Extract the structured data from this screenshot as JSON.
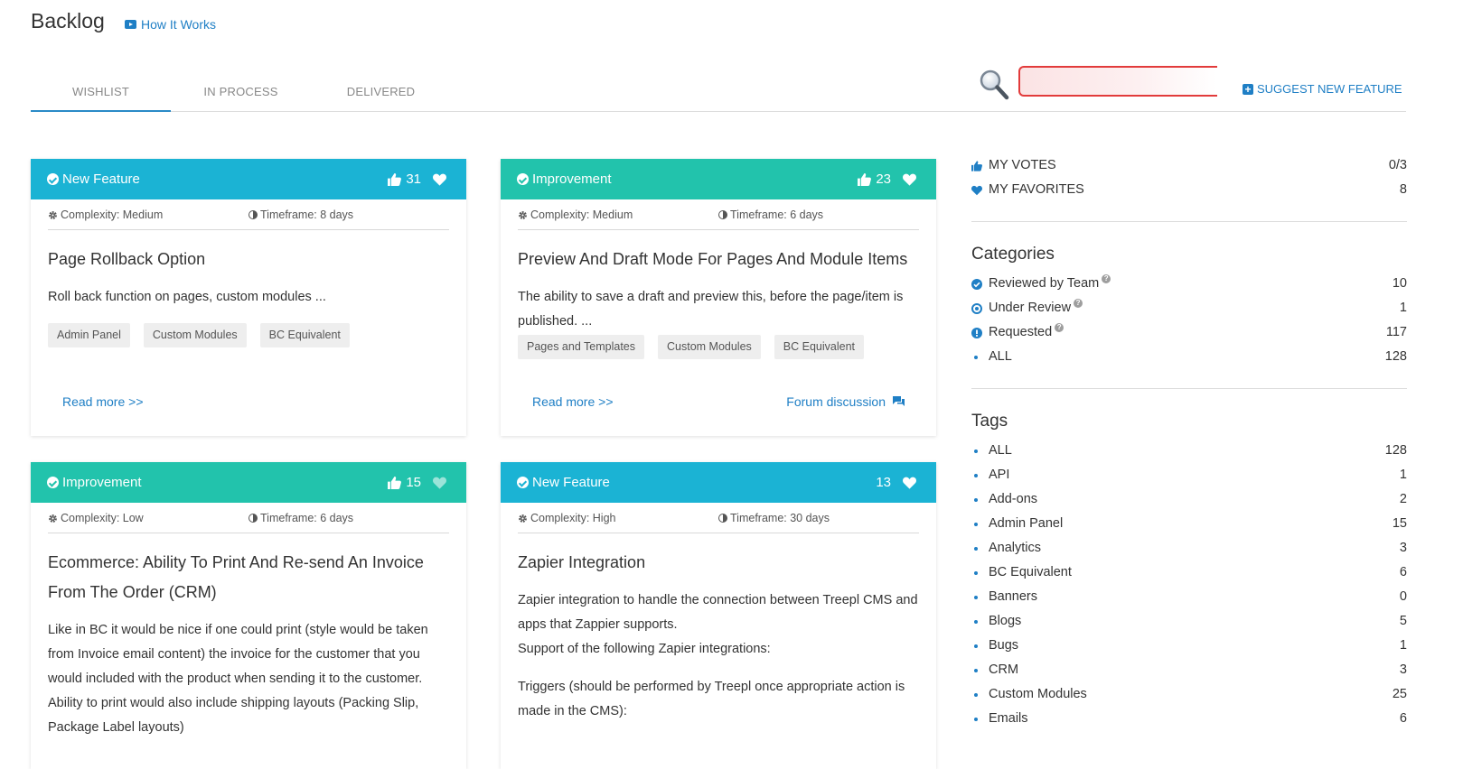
{
  "header": {
    "title": "Backlog",
    "how_it_works": "How It Works",
    "tabs": [
      "WISHLIST",
      "IN PROCESS",
      "DELIVERED"
    ],
    "suggest_label": "SUGGEST NEW FEATURE",
    "search_value": ""
  },
  "cards": [
    {
      "type": "New Feature",
      "votes": "31",
      "complexity": "Complexity: Medium",
      "timeframe": "Timeframe: 8 days",
      "title": "Page Rollback Option",
      "desc": "Roll back function on pages, custom modules ...",
      "tags": [
        "Admin Panel",
        "Custom Modules",
        "BC Equivalent"
      ],
      "read_more": "Read more >>"
    },
    {
      "type": "Improvement",
      "votes": "23",
      "complexity": "Complexity: Medium",
      "timeframe": "Timeframe: 6 days",
      "title": "Preview And Draft Mode For Pages And Module Items",
      "desc": "The ability to save a draft and preview this, before the page/item is published. ...",
      "tags": [
        "Pages and Templates",
        "Custom Modules",
        "BC Equivalent"
      ],
      "read_more": "Read more >>",
      "forum": "Forum discussion"
    },
    {
      "type": "Improvement",
      "votes": "15",
      "complexity": "Complexity: Low",
      "timeframe": "Timeframe: 6 days",
      "title": "Ecommerce: Ability To Print And Re-send An Invoice From The Order (CRM)",
      "desc": "Like in BC it would be nice if one could print (style would be taken from Invoice email content) the invoice for the customer that you would included with the product when sending it to the customer. Ability to print would also include shipping layouts (Packing Slip, Package Label layouts)"
    },
    {
      "type": "New Feature",
      "votes": "13",
      "complexity": "Complexity: High",
      "timeframe": "Timeframe: 30 days",
      "title": "Zapier Integration",
      "desc1": "Zapier integration to handle the connection between Treepl CMS and apps that Zappier supports.",
      "desc2": "Support of the following Zapier integrations:",
      "desc3": "Triggers (should be performed by Treepl once appropriate action is made in the CMS):"
    }
  ],
  "sidebar": {
    "my_votes": {
      "label": "MY VOTES",
      "count": "0/3"
    },
    "my_favorites": {
      "label": "MY FAVORITES",
      "count": "8"
    },
    "categories_title": "Categories",
    "categories": [
      {
        "label": "Reviewed by Team",
        "count": "10",
        "help": "?"
      },
      {
        "label": "Under Review",
        "count": "1",
        "help": "?"
      },
      {
        "label": "Requested",
        "count": "117",
        "help": "?"
      },
      {
        "label": "ALL",
        "count": "128"
      }
    ],
    "tags_title": "Tags",
    "tags": [
      {
        "label": "ALL",
        "count": "128"
      },
      {
        "label": "API",
        "count": "1"
      },
      {
        "label": "Add-ons",
        "count": "2"
      },
      {
        "label": "Admin Panel",
        "count": "15"
      },
      {
        "label": "Analytics",
        "count": "3"
      },
      {
        "label": "BC Equivalent",
        "count": "6"
      },
      {
        "label": "Banners",
        "count": "0"
      },
      {
        "label": "Blogs",
        "count": "5"
      },
      {
        "label": "Bugs",
        "count": "1"
      },
      {
        "label": "CRM",
        "count": "3"
      },
      {
        "label": "Custom Modules",
        "count": "25"
      },
      {
        "label": "Emails",
        "count": "6"
      }
    ]
  },
  "colors": {
    "new_feature_header": "#1bb3d4",
    "improvement_header": "#22c3ac",
    "link_blue": "#1f7fc5",
    "search_border": "#e23b3b"
  },
  "icons": {
    "tab_video": "youtube-icon",
    "search": "magnifier-icon",
    "vote": "thumbs-up-icon",
    "favorite": "heart-icon",
    "complexity": "gear-icon",
    "timeframe": "clock-icon",
    "forum": "chat-icon"
  }
}
